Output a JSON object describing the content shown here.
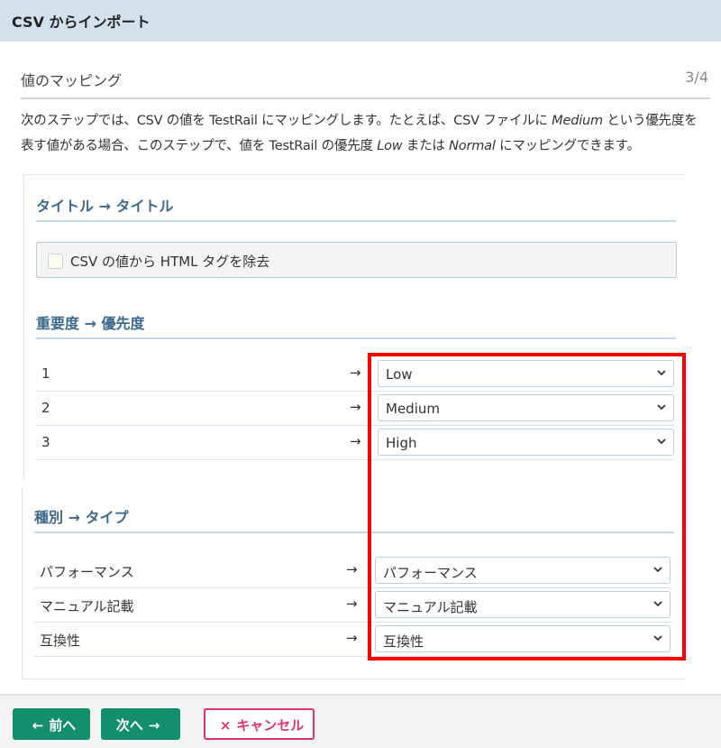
{
  "window": {
    "title": "CSV からインポート"
  },
  "step": {
    "title": "値のマッピング",
    "indicator": "3/4"
  },
  "description": {
    "line1_a": "次のステップでは、CSV の値を TestRail にマッピングします。たとえば、CSV ファイルに ",
    "line1_em": "Medium",
    "line1_b": " という優先度を",
    "line2_a": "表す値がある場合、このステップで、値を TestRail の優先度 ",
    "line2_em1": "Low",
    "line2_b": " または ",
    "line2_em2": "Normal",
    "line2_c": " にマッピングできます。"
  },
  "groups": [
    {
      "title": "タイトル → タイトル",
      "checkbox": {
        "label": "CSV の値から HTML タグを除去",
        "checked": false
      }
    },
    {
      "title": "重要度 → 優先度",
      "rows": [
        {
          "source": "1",
          "arrow": "→",
          "target": "Low"
        },
        {
          "source": "2",
          "arrow": "→",
          "target": "Medium"
        },
        {
          "source": "3",
          "arrow": "→",
          "target": "High"
        }
      ]
    },
    {
      "title": "種別 → タイプ",
      "rows": [
        {
          "source": "パフォーマンス",
          "arrow": "→",
          "target": "パフォーマンス"
        },
        {
          "source": "マニュアル記載",
          "arrow": "→",
          "target": "マニュアル記載"
        },
        {
          "source": "互換性",
          "arrow": "→",
          "target": "互換性"
        }
      ]
    }
  ],
  "footer": {
    "prev_label": "前へ",
    "prev_icon": "←",
    "next_label": "次へ",
    "next_icon": "→",
    "cancel_label": "キャンセル",
    "cancel_icon": "×"
  },
  "colors": {
    "accent_green": "#148f6e",
    "cancel_pink": "#e1336a",
    "highlight_red": "#ff0000",
    "titlebar_bg": "#d3e1ec",
    "group_title": "#3d6a8c"
  }
}
